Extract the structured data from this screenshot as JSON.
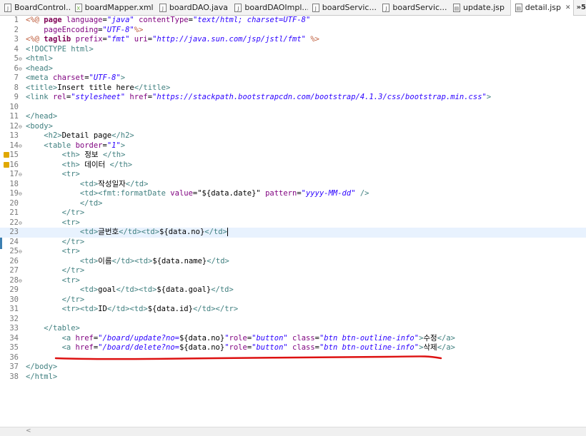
{
  "tabs": [
    {
      "label": "BoardControl...",
      "icon": "J",
      "active": false
    },
    {
      "label": "boardMapper.xml",
      "icon": "X",
      "active": false
    },
    {
      "label": "boardDAO.java",
      "icon": "J",
      "active": false
    },
    {
      "label": "boardDAOImpl...",
      "icon": "J",
      "active": false
    },
    {
      "label": "boardServic...",
      "icon": "J",
      "active": false
    },
    {
      "label": "boardServic...",
      "icon": "J",
      "active": false
    },
    {
      "label": "update.jsp",
      "icon": "▤",
      "active": false
    },
    {
      "label": "detail.jsp",
      "icon": "▤",
      "active": true
    }
  ],
  "tab_close": "✕",
  "tab_overflow": "»5",
  "editor": {
    "current_line": 23,
    "lines": [
      [
        [
          "p",
          "<%@ "
        ],
        [
          "k",
          "page "
        ],
        [
          "a",
          "language"
        ],
        [
          "",
          "="
        ],
        [
          "s",
          "\"java\""
        ],
        [
          "",
          " "
        ],
        [
          "a",
          "contentType"
        ],
        [
          "",
          "="
        ],
        [
          "s",
          "\"text/html; charset=UTF-8\""
        ]
      ],
      [
        [
          "",
          "    "
        ],
        [
          "a",
          "pageEncoding"
        ],
        [
          "",
          "="
        ],
        [
          "s",
          "\"UTF-8\""
        ],
        [
          "p",
          "%>"
        ]
      ],
      [
        [
          "p",
          "<%@ "
        ],
        [
          "k",
          "taglib "
        ],
        [
          "a",
          "prefix"
        ],
        [
          "",
          "="
        ],
        [
          "s",
          "\"fmt\""
        ],
        [
          "",
          " "
        ],
        [
          "a",
          "uri"
        ],
        [
          "",
          "="
        ],
        [
          "s",
          "\"http://java.sun.com/jsp/jstl/fmt\""
        ],
        [
          "",
          " "
        ],
        [
          "p",
          "%>"
        ]
      ],
      [
        [
          "t",
          "<!DOCTYPE html>"
        ]
      ],
      [
        [
          "t",
          "<html>"
        ]
      ],
      [
        [
          "t",
          "<head>"
        ]
      ],
      [
        [
          "t",
          "<meta "
        ],
        [
          "a",
          "charset"
        ],
        [
          "",
          "="
        ],
        [
          "s",
          "\"UTF-8\""
        ],
        [
          "t",
          ">"
        ]
      ],
      [
        [
          "t",
          "<title>"
        ],
        [
          "",
          "Insert title here"
        ],
        [
          "t",
          "</title>"
        ]
      ],
      [
        [
          "t",
          "<link "
        ],
        [
          "a",
          "rel"
        ],
        [
          "",
          "="
        ],
        [
          "s",
          "\"stylesheet\""
        ],
        [
          "",
          " "
        ],
        [
          "a",
          "href"
        ],
        [
          "",
          "="
        ],
        [
          "s",
          "\"https://stackpath.bootstrapcdn.com/bootstrap/4.1.3/css/bootstrap.min.css\""
        ],
        [
          "t",
          ">"
        ]
      ],
      [],
      [
        [
          "t",
          "</head>"
        ]
      ],
      [
        [
          "t",
          "<body>"
        ]
      ],
      [
        [
          "",
          "    "
        ],
        [
          "t",
          "<h2>"
        ],
        [
          "",
          "Detail page"
        ],
        [
          "t",
          "</h2>"
        ]
      ],
      [
        [
          "",
          "    "
        ],
        [
          "t",
          "<table "
        ],
        [
          "a",
          "border"
        ],
        [
          "",
          "="
        ],
        [
          "s",
          "\"1\""
        ],
        [
          "t",
          ">"
        ]
      ],
      [
        [
          "",
          "        "
        ],
        [
          "t",
          "<th>"
        ],
        [
          "",
          " 정보 "
        ],
        [
          "t",
          "</th>"
        ]
      ],
      [
        [
          "",
          "        "
        ],
        [
          "t",
          "<th>"
        ],
        [
          "",
          " 데이터 "
        ],
        [
          "t",
          "</th>"
        ]
      ],
      [
        [
          "",
          "        "
        ],
        [
          "t",
          "<tr>"
        ]
      ],
      [
        [
          "",
          "            "
        ],
        [
          "t",
          "<td>"
        ],
        [
          "",
          "작성일자"
        ],
        [
          "t",
          "</td>"
        ]
      ],
      [
        [
          "",
          "            "
        ],
        [
          "t",
          "<td><fmt:formatDate "
        ],
        [
          "a",
          "value"
        ],
        [
          "",
          "=\"${data.date}\" "
        ],
        [
          "a",
          "pattern"
        ],
        [
          "",
          "="
        ],
        [
          "s",
          "\"yyyy-MM-dd\""
        ],
        [
          "",
          " "
        ],
        [
          "t",
          "/>"
        ]
      ],
      [
        [
          "",
          "            "
        ],
        [
          "t",
          "</td>"
        ]
      ],
      [
        [
          "",
          "        "
        ],
        [
          "t",
          "</tr>"
        ]
      ],
      [
        [
          "",
          "        "
        ],
        [
          "t",
          "<tr>"
        ]
      ],
      [
        [
          "",
          "            "
        ],
        [
          "t",
          "<td>"
        ],
        [
          "",
          "글번호"
        ],
        [
          "t",
          "</td><td>"
        ],
        [
          "",
          "${data.no}"
        ],
        [
          "t",
          "</td>"
        ]
      ],
      [
        [
          "",
          "        "
        ],
        [
          "t",
          "</tr>"
        ]
      ],
      [
        [
          "",
          "        "
        ],
        [
          "t",
          "<tr>"
        ]
      ],
      [
        [
          "",
          "            "
        ],
        [
          "t",
          "<td>"
        ],
        [
          "",
          "이름"
        ],
        [
          "t",
          "</td><td>"
        ],
        [
          "",
          "${data.name}"
        ],
        [
          "t",
          "</td>"
        ]
      ],
      [
        [
          "",
          "        "
        ],
        [
          "t",
          "</tr>"
        ]
      ],
      [
        [
          "",
          "        "
        ],
        [
          "t",
          "<tr>"
        ]
      ],
      [
        [
          "",
          "            "
        ],
        [
          "t",
          "<td>"
        ],
        [
          "",
          "goal"
        ],
        [
          "t",
          "</td><td>"
        ],
        [
          "",
          "${data.goal}"
        ],
        [
          "t",
          "</td>"
        ]
      ],
      [
        [
          "",
          "        "
        ],
        [
          "t",
          "</tr>"
        ]
      ],
      [
        [
          "",
          "        "
        ],
        [
          "t",
          "<tr><td>"
        ],
        [
          "",
          "ID"
        ],
        [
          "t",
          "</td><td>"
        ],
        [
          "",
          "${data.id}"
        ],
        [
          "t",
          "</td></tr>"
        ]
      ],
      [],
      [
        [
          "",
          "    "
        ],
        [
          "t",
          "</table>"
        ]
      ],
      [
        [
          "",
          "        "
        ],
        [
          "t",
          "<a "
        ],
        [
          "a",
          "href"
        ],
        [
          "",
          "="
        ],
        [
          "s",
          "\"/board/update?no="
        ],
        [
          "",
          "${data.no}"
        ],
        [
          "s",
          "\""
        ],
        [
          "a",
          "role"
        ],
        [
          "",
          "="
        ],
        [
          "s",
          "\"button\""
        ],
        [
          "",
          " "
        ],
        [
          "a",
          "class"
        ],
        [
          "",
          "="
        ],
        [
          "s",
          "\"btn btn-outline-info\""
        ],
        [
          "t",
          ">"
        ],
        [
          "",
          "수정"
        ],
        [
          "t",
          "</a>"
        ]
      ],
      [
        [
          "",
          "        "
        ],
        [
          "t",
          "<a "
        ],
        [
          "a",
          "href"
        ],
        [
          "",
          "="
        ],
        [
          "s",
          "\"/board/delete?no="
        ],
        [
          "",
          "${data.no}"
        ],
        [
          "s",
          "\""
        ],
        [
          "a",
          "role"
        ],
        [
          "",
          "="
        ],
        [
          "s",
          "\"button\""
        ],
        [
          "",
          " "
        ],
        [
          "a",
          "class"
        ],
        [
          "",
          "="
        ],
        [
          "s",
          "\"btn btn-outline-info\""
        ],
        [
          "t",
          ">"
        ],
        [
          "",
          "삭제"
        ],
        [
          "t",
          "</a>"
        ]
      ],
      [],
      [
        [
          "t",
          "</body>"
        ]
      ],
      [
        [
          "t",
          "</html>"
        ]
      ]
    ],
    "fold_lines": [
      5,
      6,
      12,
      14,
      17,
      19,
      22,
      25,
      28
    ],
    "warning_lines": [
      15,
      16
    ]
  },
  "scroll": {
    "left_arrow": "<"
  },
  "colors": {
    "tag": "#3f7f7f",
    "attribute": "#7f007f",
    "string": "#2a00ff",
    "keyword": "#7f0055",
    "directive": "#bf5f3f",
    "current_line": "#e8f2fe",
    "annotation_underline": "#dd1111"
  }
}
